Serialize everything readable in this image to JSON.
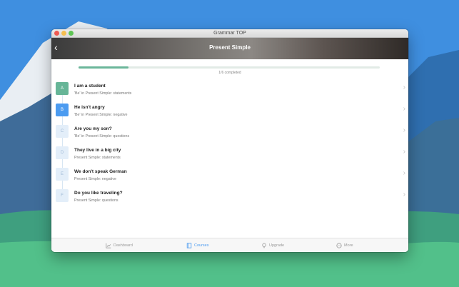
{
  "window": {
    "title": "Grammar TOP"
  },
  "header": {
    "back_glyph": "‹",
    "title": "Present Simple"
  },
  "progress": {
    "fraction": 0.1667,
    "label": "1/6 completed"
  },
  "lessons": [
    {
      "letter": "A",
      "title": "I am a student",
      "subtitle": "'Be' in Present Simple: statements",
      "state": "done"
    },
    {
      "letter": "B",
      "title": "He isn't angry",
      "subtitle": "'Be' in Present Simple: negative",
      "state": "current"
    },
    {
      "letter": "C",
      "title": "Are you my son?",
      "subtitle": "'Be' in Present Simple: questions",
      "state": "locked"
    },
    {
      "letter": "D",
      "title": "They live in a big city",
      "subtitle": "Present Simple: statements",
      "state": "locked"
    },
    {
      "letter": "E",
      "title": "We don't speak German",
      "subtitle": "Present Simple: negative",
      "state": "locked"
    },
    {
      "letter": "F",
      "title": "Do you like traveling?",
      "subtitle": "Present Simple: questions",
      "state": "locked"
    }
  ],
  "tabs": [
    {
      "label": "Dashboard",
      "icon": "chart-icon",
      "active": false
    },
    {
      "label": "Courses",
      "icon": "book-icon",
      "active": true
    },
    {
      "label": "Upgrade",
      "icon": "bulb-icon",
      "active": false
    },
    {
      "label": "More",
      "icon": "more-icon",
      "active": false
    }
  ],
  "colors": {
    "done": "#66b597",
    "current": "#4b9bf0",
    "locked": "#e3eef9",
    "accent": "#4b9bf0"
  }
}
